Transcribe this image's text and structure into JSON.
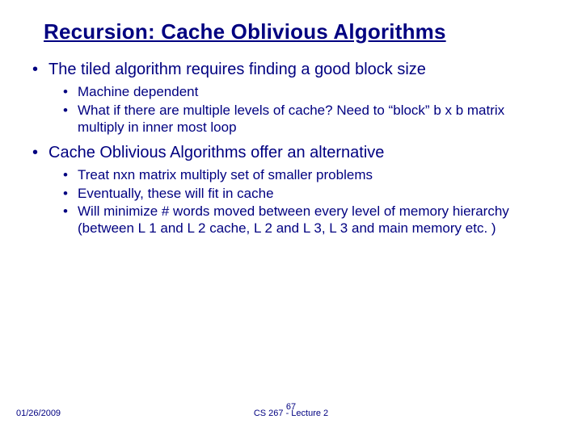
{
  "title": "Recursion: Cache Oblivious Algorithms",
  "bullets": {
    "b1": "The tiled algorithm requires finding a good block size",
    "b1a": "Machine dependent",
    "b1b": "What if there are multiple levels of cache? Need to “block” b x b matrix multiply in inner most loop",
    "b2": "Cache Oblivious Algorithms offer an alternative",
    "b2a": "Treat nxn matrix multiply set of smaller problems",
    "b2b": "Eventually, these will fit in cache",
    "b2c": "Will minimize # words moved between every level of memory hierarchy (between L 1 and L 2 cache, L 2 and L 3, L 3 and main memory etc. )"
  },
  "footer": {
    "date": "01/26/2009",
    "center": "CS 267 - Lecture 2",
    "page": "67"
  }
}
